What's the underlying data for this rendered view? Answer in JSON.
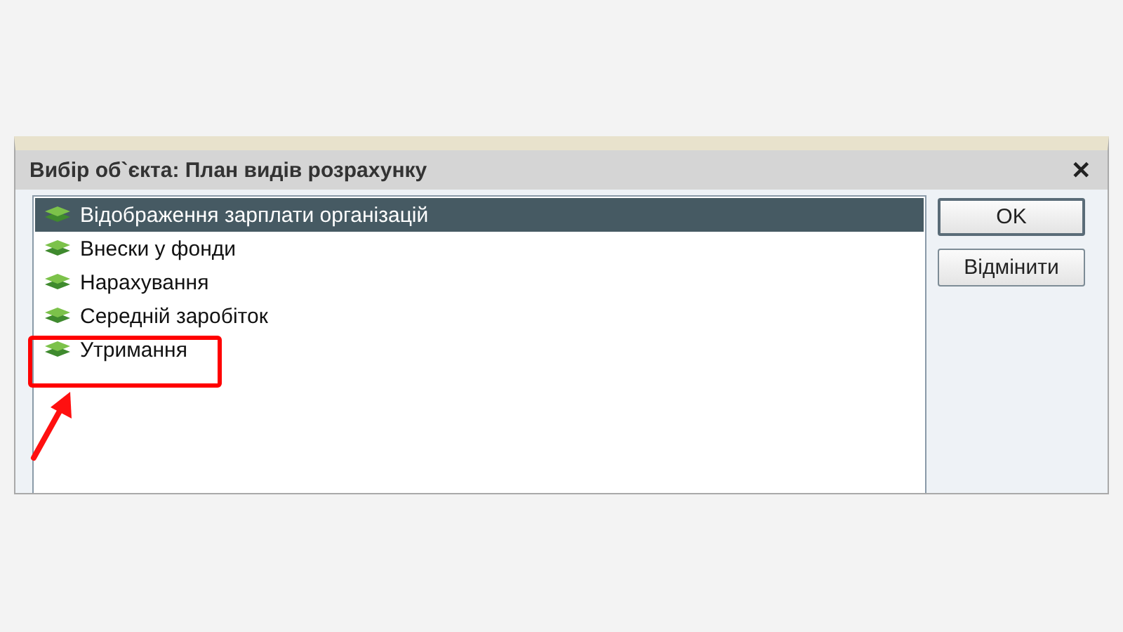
{
  "window": {
    "title": "Вибір об`єкта: План видів розрахунку",
    "close": "✕"
  },
  "list": [
    {
      "label": "Відображення зарплати організацій",
      "selected": true
    },
    {
      "label": "Внески у фонди",
      "selected": false
    },
    {
      "label": "Нарахування",
      "selected": false
    },
    {
      "label": "Середній заробіток",
      "selected": false
    },
    {
      "label": "Утримання",
      "selected": false
    }
  ],
  "buttons": [
    {
      "label": "OK",
      "default": true
    },
    {
      "label": "Відмінити",
      "default": false
    }
  ]
}
